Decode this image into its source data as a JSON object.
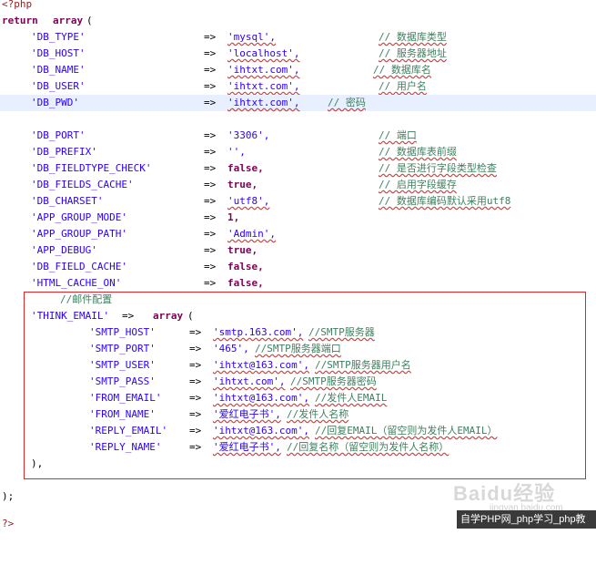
{
  "code": {
    "php_open": "<?php",
    "return_kw": "return",
    "array_kw": "array",
    "paren_open": "(",
    "arrow": "=>",
    "entries": [
      {
        "key": "'DB_TYPE'",
        "value": "'mysql',",
        "comment": "// 数据库类型"
      },
      {
        "key": "'DB_HOST'",
        "value": "'localhost',",
        "comment": "// 服务器地址"
      },
      {
        "key": "'DB_NAME'",
        "value": "'ihtxt.com',",
        "comment": "// 数据库名"
      },
      {
        "key": "'DB_USER'",
        "value": "'ihtxt.com',",
        "comment": "// 用户名"
      },
      {
        "key": "'DB_PWD'",
        "value": "'ihtxt.com',",
        "comment": "// 密码"
      },
      {
        "key": "'DB_PORT'",
        "value": "'3306',",
        "comment": "// 端口"
      },
      {
        "key": "'DB_PREFIX'",
        "value": "'',",
        "comment": "// 数据库表前缀"
      },
      {
        "key": "'DB_FIELDTYPE_CHECK'",
        "value": "false,",
        "comment": "// 是否进行字段类型检查"
      },
      {
        "key": "'DB_FIELDS_CACHE'",
        "value": "true,",
        "comment": "// 启用字段缓存"
      },
      {
        "key": "'DB_CHARSET'",
        "value": "'utf8',",
        "comment": "// 数据库编码默认采用utf8"
      },
      {
        "key": "'APP_GROUP_MODE'",
        "value": "1,",
        "comment": ""
      },
      {
        "key": "'APP_GROUP_PATH'",
        "value": "'Admin',",
        "comment": ""
      },
      {
        "key": "'APP_DEBUG'",
        "value": "true,",
        "comment": ""
      },
      {
        "key": "'DB_FIELD_CACHE'",
        "value": "false,",
        "comment": ""
      },
      {
        "key": "'HTML_CACHE_ON'",
        "value": "false,",
        "comment": ""
      }
    ],
    "mail_comment": "//邮件配置",
    "think_email_key": "'THINK_EMAIL'",
    "mail_entries": [
      {
        "key": "'SMTP_HOST'",
        "value": "'smtp.163.com',",
        "comment": "//SMTP服务器"
      },
      {
        "key": "'SMTP_PORT'",
        "value": "'465',",
        "comment": "//SMTP服务器端口"
      },
      {
        "key": "'SMTP_USER'",
        "value": "'ihtxt@163.com',",
        "comment": "//SMTP服务器用户名"
      },
      {
        "key": "'SMTP_PASS'",
        "value": "'ihtxt.com',",
        "comment": "//SMTP服务器密码"
      },
      {
        "key": "'FROM_EMAIL'",
        "value": "'ihtxt@163.com',",
        "comment": "//发件人EMAIL"
      },
      {
        "key": "'FROM_NAME'",
        "value": "'爱红电子书',",
        "comment": "//发件人名称"
      },
      {
        "key": "'REPLY_EMAIL'",
        "value": "'ihtxt@163.com',",
        "comment": "//回复EMAIL（留空则为发件人EMAIL）"
      },
      {
        "key": "'REPLY_NAME'",
        "value": "'爱红电子书',",
        "comment": "//回复名称（留空则为发件人名称）"
      }
    ],
    "mail_close": "),",
    "array_close": ");",
    "php_close": "?>"
  },
  "watermark": {
    "brand": "Baidu经验",
    "sub": "jingyan.baidu.com"
  },
  "footer": {
    "text": "自学PHP网_php学习_php教"
  },
  "colors": {
    "keyword": "#7f0055",
    "string": "#2a00ff",
    "comment": "#3f7f5f",
    "highlight": "#e8f0ff",
    "box": "#d8282e"
  }
}
